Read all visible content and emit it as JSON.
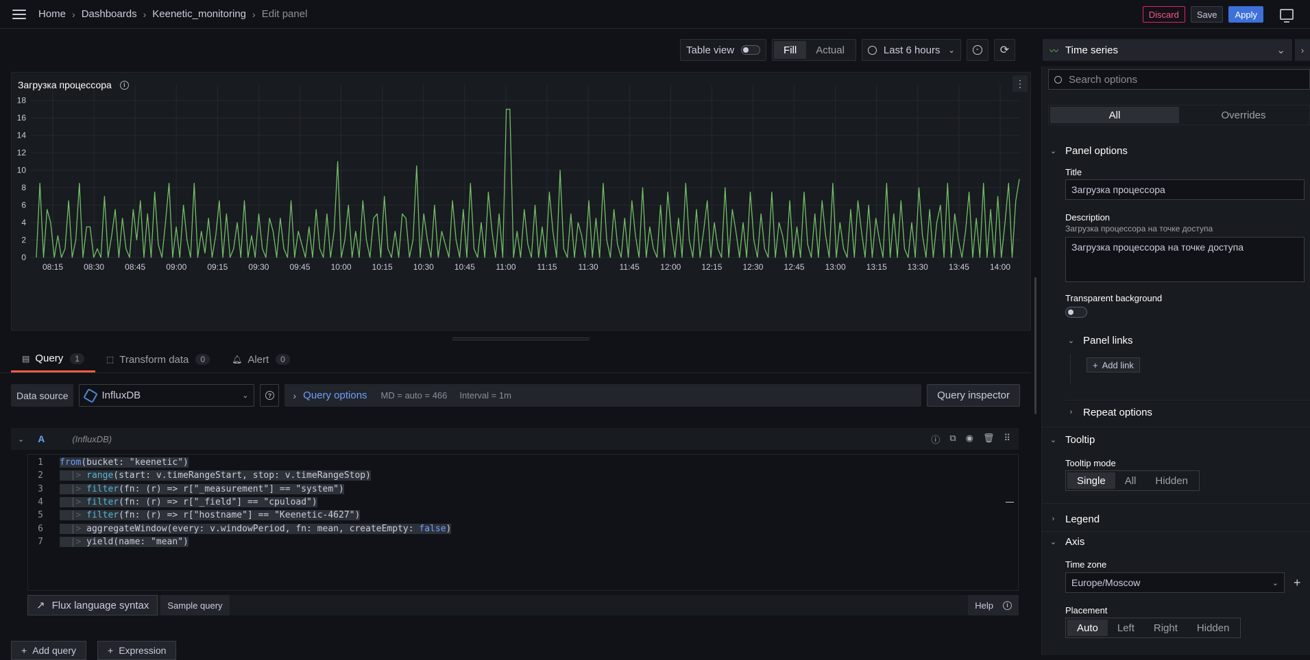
{
  "breadcrumb": {
    "items": [
      "Home",
      "Dashboards",
      "Keenetic_monitoring"
    ],
    "current": "Edit panel"
  },
  "top_actions": {
    "discard": "Discard",
    "save": "Save",
    "apply": "Apply"
  },
  "toolbar": {
    "table_view": "Table view",
    "fill": "Fill",
    "actual": "Actual",
    "time_range": "Last 6 hours"
  },
  "panel": {
    "title": "Загрузка процессора"
  },
  "chart_data": {
    "type": "line",
    "title": "Загрузка процессора",
    "xlabel": "",
    "ylabel": "",
    "ylim": [
      0,
      19
    ],
    "y_ticks": [
      "0",
      "2",
      "4",
      "6",
      "8",
      "10",
      "12",
      "14",
      "16",
      "18"
    ],
    "x_ticks": [
      "08:15",
      "08:30",
      "08:45",
      "09:00",
      "09:15",
      "09:30",
      "09:45",
      "10:00",
      "10:15",
      "10:30",
      "10:45",
      "11:00",
      "11:15",
      "11:30",
      "11:45",
      "12:00",
      "12:15",
      "12:30",
      "12:45",
      "13:00",
      "13:15",
      "13:30",
      "13:45",
      "14:00"
    ],
    "grid": true,
    "color": "#73bf69",
    "series": [
      {
        "values": [
          0,
          8.5,
          0,
          5.5,
          4,
          0,
          2.5,
          0,
          1,
          6.5,
          0,
          2,
          8.5,
          0,
          3.5,
          3.5,
          0,
          1,
          0,
          7,
          0,
          2.5,
          5.5,
          0,
          4.5,
          1,
          0,
          5.5,
          2,
          6.5,
          0,
          5,
          0,
          7.5,
          1.5,
          0,
          4,
          8.5,
          0,
          3.5,
          0,
          6,
          2,
          0,
          8.5,
          0,
          3,
          0.5,
          4.5,
          0,
          2.5,
          6.5,
          0,
          5,
          0,
          1,
          4,
          0,
          6.5,
          0,
          2.5,
          0,
          5,
          1,
          0,
          4.5,
          3,
          0,
          4.5,
          1,
          0,
          6.5,
          0,
          3,
          1.5,
          0,
          3.5,
          0,
          5.5,
          1,
          0,
          5,
          0,
          3,
          11,
          0,
          2,
          6,
          0,
          3,
          0,
          6.5,
          2,
          0,
          4.5,
          5,
          0,
          7,
          1,
          0,
          3,
          0,
          5,
          4.5,
          0,
          2,
          10.5,
          0,
          5,
          2,
          0,
          6,
          0,
          3,
          1.5,
          0,
          6.5,
          2,
          0,
          5.5,
          0,
          8.5,
          1,
          0,
          4,
          0,
          7.5,
          3,
          0,
          5,
          0,
          17,
          17,
          0,
          3,
          0,
          5.5,
          1.5,
          0,
          6,
          0,
          3.5,
          0,
          7.5,
          3,
          0,
          10,
          1,
          0,
          5,
          0,
          4,
          2.5,
          0,
          6.5,
          0,
          4.5,
          0,
          8.5,
          2,
          0,
          5.5,
          1.5,
          0,
          4.5,
          0,
          6.5,
          2.5,
          0,
          8,
          0,
          3.5,
          1,
          0,
          6,
          0,
          7.5,
          3,
          0,
          4.5,
          0,
          8.5,
          2,
          0,
          5.5,
          0,
          3,
          6.5,
          0,
          4,
          1,
          0,
          8,
          0,
          5.5,
          3,
          0,
          4,
          0,
          7.5,
          2,
          0,
          5,
          1,
          0,
          7.5,
          0,
          4,
          2.5,
          0,
          6.5,
          0,
          3.5,
          0,
          7.5,
          1.5,
          0,
          5,
          0,
          6.5,
          2.5,
          0,
          8.5,
          0,
          4,
          1,
          0,
          5.5,
          0,
          6.5,
          3,
          0,
          6,
          0,
          4.5,
          2,
          0,
          8.5,
          0,
          5,
          0,
          6.5,
          1,
          0,
          4,
          0,
          8,
          2.5,
          0,
          5.5,
          0,
          4,
          6,
          0,
          8.5,
          0,
          5,
          2,
          0,
          3,
          7.5,
          0,
          4.5,
          0,
          8.5,
          0,
          5.5,
          0,
          7,
          0,
          4,
          8.5,
          0,
          6.5,
          9
        ]
      }
    ]
  },
  "tabs": [
    {
      "label": "Query",
      "count": "1"
    },
    {
      "label": "Transform data",
      "count": "0"
    },
    {
      "label": "Alert",
      "count": "0"
    }
  ],
  "query_row": {
    "ds_label": "Data source",
    "ds_value": "InfluxDB",
    "options_link": "Query options",
    "md": "MD = auto = 466",
    "interval": "Interval = 1m",
    "inspector": "Query inspector"
  },
  "query": {
    "letter": "A",
    "datasource": "(InfluxDB)",
    "line_numbers": [
      "1",
      "2",
      "3",
      "4",
      "5",
      "6",
      "7"
    ],
    "lines": [
      [
        "",
        "from",
        "(bucket: \"keenetic\")",
        "",
        ""
      ],
      [
        "  |> ",
        "range",
        "(start: v.timeRangeStart, stop: v.timeRangeStop)",
        "",
        ""
      ],
      [
        "  |> ",
        "filter",
        "(fn: (r) => r[\"_measurement\"] == \"system\")",
        "",
        ""
      ],
      [
        "  |> ",
        "filter",
        "(fn: (r) => r[\"_field\"] == \"cpuload\")",
        "",
        ""
      ],
      [
        "  |> ",
        "filter",
        "(fn: (r) => r[\"hostname\"] == \"Keenetic-4627\")",
        "",
        ""
      ],
      [
        "  |> ",
        "",
        "aggregateWindow(every: v.windowPeriod, fn: mean, createEmpty: ",
        "false",
        ")"
      ],
      [
        "  |> ",
        "",
        "yield(name: \"mean\")",
        "",
        ""
      ]
    ],
    "flux_syntax": "Flux language syntax",
    "sample_query": "Sample query",
    "help": "Help",
    "add_query": "Add query",
    "expression": "Expression"
  },
  "sidebar": {
    "viz_type": "Time series",
    "search_placeholder": "Search options",
    "all": "All",
    "overrides": "Overrides",
    "panel_options": "Panel options",
    "title_label": "Title",
    "title_value": "Загрузка процессора",
    "description_label": "Description",
    "description_hint": "Загрузка процессора на точке доступа",
    "description_value": "Загрузка процессора на точке доступа",
    "transparent_bg": "Transparent background",
    "panel_links": "Panel links",
    "add_link": "Add link",
    "repeat_options": "Repeat options",
    "tooltip": "Tooltip",
    "tooltip_mode": "Tooltip mode",
    "tooltip_single": "Single",
    "tooltip_all": "All",
    "tooltip_hidden": "Hidden",
    "legend": "Legend",
    "axis": "Axis",
    "time_zone": "Time zone",
    "time_zone_value": "Europe/Moscow",
    "placement": "Placement",
    "placement_auto": "Auto",
    "placement_left": "Left",
    "placement_right": "Right",
    "placement_hidden": "Hidden"
  }
}
